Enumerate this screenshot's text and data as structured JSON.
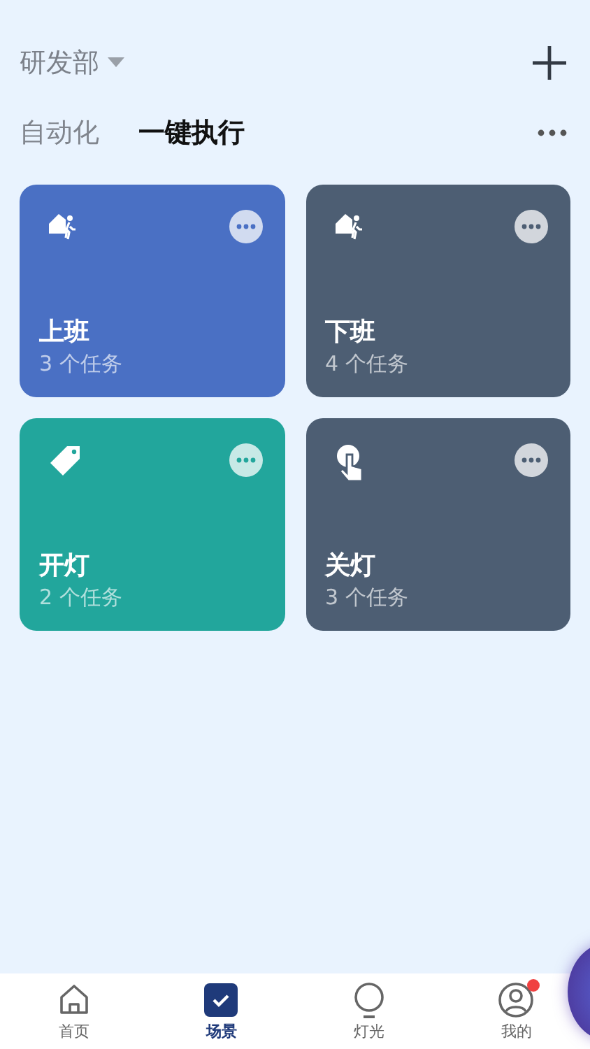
{
  "header": {
    "title": "研发部"
  },
  "tabs": [
    {
      "label": "自动化",
      "selected": false
    },
    {
      "label": "一键执行",
      "selected": true
    }
  ],
  "scenes": [
    {
      "name": "上班",
      "tasks": "3 个任务",
      "kind": "leave-home",
      "color": "#4a70c4"
    },
    {
      "name": "下班",
      "tasks": "4 个任务",
      "kind": "leave-home",
      "color": "#4d5e73"
    },
    {
      "name": "开灯",
      "tasks": "2 个任务",
      "kind": "tag",
      "color": "#22a69c"
    },
    {
      "name": "关灯",
      "tasks": "3 个任务",
      "kind": "tap",
      "color": "#4d5e73"
    }
  ],
  "nav": [
    {
      "label": "首页",
      "kind": "home",
      "selected": false,
      "badge": false
    },
    {
      "label": "场景",
      "kind": "scene",
      "selected": true,
      "badge": false
    },
    {
      "label": "灯光",
      "kind": "bulb",
      "selected": false,
      "badge": false
    },
    {
      "label": "我的",
      "kind": "profile",
      "selected": false,
      "badge": true
    }
  ]
}
